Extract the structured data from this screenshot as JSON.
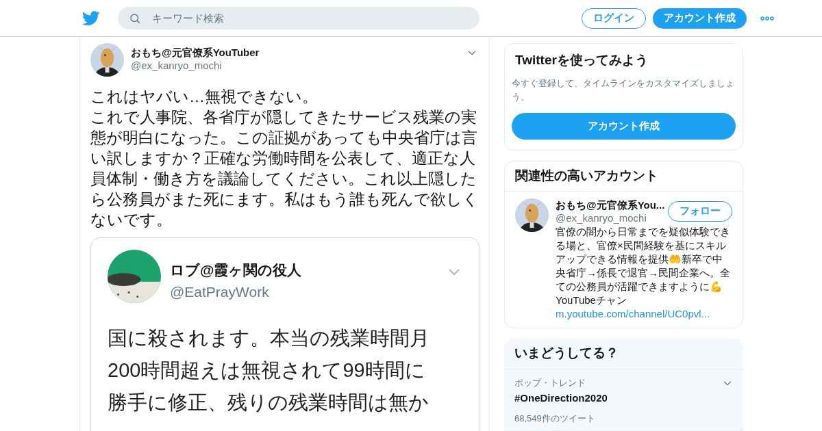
{
  "header": {
    "search": {
      "placeholder": "キーワード検索"
    },
    "login": "ログイン",
    "signup": "アカウント作成"
  },
  "tweet": {
    "name": "おもち@元官僚系YouTuber",
    "handle": "@ex_kanryo_mochi",
    "paragraphs": [
      "これはヤバい…無視できない。",
      "これで人事院、各省庁が隠してきたサービス残業の実態が明白になった。この証拠があっても中央省庁は言い訳しますか？正確な労働時間を公表して、適正な人員体制・働き方を議論してください。これ以上隠したら公務員がまた死にます。私はもう誰も死んで欲しくないです。"
    ],
    "embed": {
      "name": "ロブ@霞ヶ関の役人",
      "handle": "@EatPrayWork",
      "lines": [
        "国に殺されます。本当の残業時間月",
        "200時間超えは無視されて99時間に",
        "勝手に修正、残りの残業時間は無か"
      ]
    }
  },
  "signup_card": {
    "title": "Twitterを使ってみよう",
    "text": "今すぐ登録して、タイムラインをカスタマイズしましょう。",
    "button": "アカウント作成"
  },
  "related": {
    "title": "関連性の高いアカウント",
    "accounts": [
      {
        "name": "おもち@元官僚系You...",
        "handle": "@ex_kanryo_mochi",
        "follow": "フォロー",
        "bio": "官僚の闇から日常までを疑似体験できる場と、官僚×民間経験を基にスキルアップできる情報を提供🤲新卒で中央省庁→係長で退官→民間企業へ。全ての公務員が活躍できますように💪YouTubeチャン",
        "link": "m.youtube.com/channel/UC0pvl..."
      }
    ]
  },
  "trends": {
    "title": "いまどうしてる？",
    "items": [
      {
        "category": "ポップ・トレンド",
        "name": "#OneDirection2020",
        "count": "68,549件のツイート"
      }
    ]
  }
}
